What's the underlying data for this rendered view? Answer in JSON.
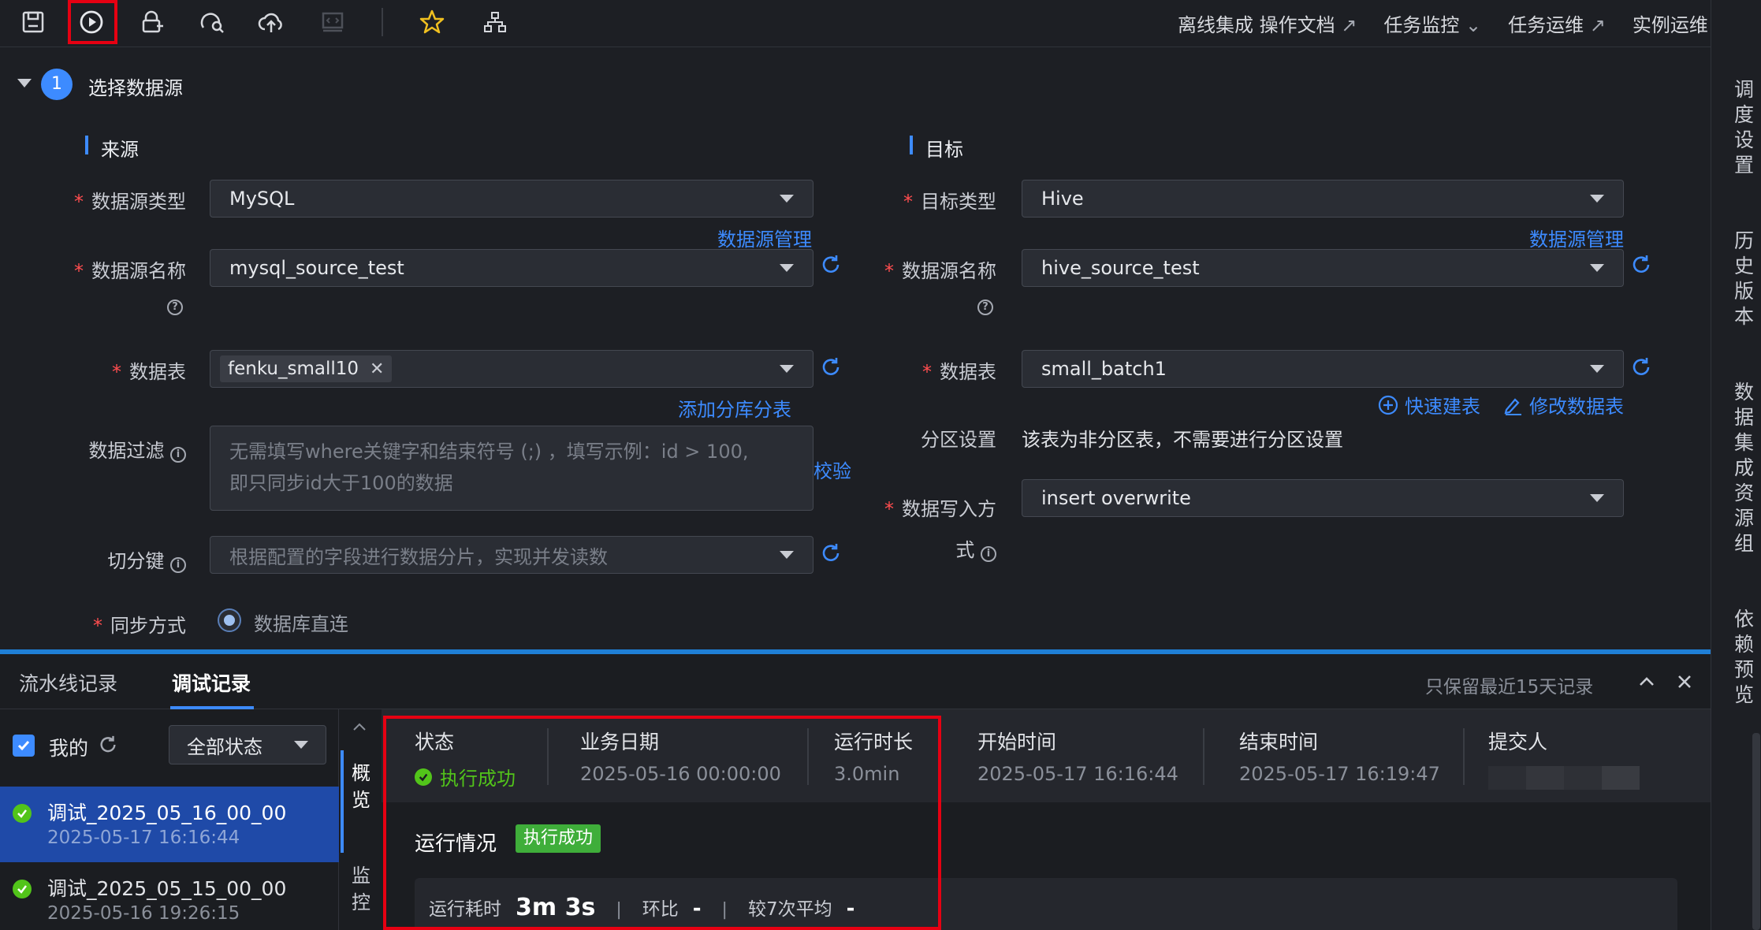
{
  "toolbar": {
    "icons": [
      "save-icon",
      "run-icon",
      "lock-icon",
      "search-icon",
      "cloud-upload-icon",
      "code-icon",
      "star-icon",
      "tree-icon"
    ],
    "links": [
      {
        "label": "离线集成 操作文档",
        "suffix": "↗"
      },
      {
        "label": "任务监控",
        "suffix": "⌄"
      },
      {
        "label": "任务运维",
        "suffix": "↗"
      },
      {
        "label": "实例运维",
        "suffix": "↗"
      }
    ]
  },
  "section": {
    "step": "1",
    "title": "选择数据源"
  },
  "source": {
    "heading": "来源",
    "type_label": "数据源类型",
    "type_value": "MySQL",
    "manage_link": "数据源管理",
    "name_label": "数据源名称",
    "name_value": "mysql_source_test",
    "table_label": "数据表",
    "table_tag": "fenku_small10",
    "add_shard_link": "添加分库分表",
    "filter_label": "数据过滤",
    "filter_placeholder_line1": "无需填写where关键字和结束符号 (;) ，填写示例：id > 100,",
    "filter_placeholder_line2": "即只同步id大于100的数据",
    "verify_link": "校验",
    "split_label": "切分键",
    "split_placeholder": "根据配置的字段进行数据分片，实现并发读数",
    "sync_label": "同步方式",
    "sync_option": "数据库直连"
  },
  "target": {
    "heading": "目标",
    "type_label": "目标类型",
    "type_value": "Hive",
    "manage_link": "数据源管理",
    "name_label": "数据源名称",
    "name_value": "hive_source_test",
    "table_label": "数据表",
    "table_value": "small_batch1",
    "quick_create_link": "快速建表",
    "modify_table_link": "修改数据表",
    "partition_label": "分区设置",
    "partition_text": "该表为非分区表，不需要进行分区设置",
    "write_label_line1": "数据写入方",
    "write_label_line2": "式",
    "write_value": "insert overwrite"
  },
  "right_rail": [
    "调度设置",
    "历史版本",
    "数据集成资源组",
    "依赖预览"
  ],
  "bottom": {
    "tabs": [
      "流水线记录",
      "调试记录"
    ],
    "active_tab": 1,
    "retention_note": "只保留最近15天记录",
    "mine_label": "我的",
    "status_filter": "全部状态",
    "records": [
      {
        "name": "调试_2025_05_16_00_00",
        "time": "2025-05-17 16:16:44"
      },
      {
        "name": "调试_2025_05_15_00_00",
        "time": "2025-05-16 19:26:15"
      }
    ],
    "side_tabs": [
      "概览",
      "监控"
    ],
    "columns": [
      {
        "head": "状态",
        "value": "执行成功"
      },
      {
        "head": "业务日期",
        "value": "2025-05-16 00:00:00"
      },
      {
        "head": "运行时长",
        "value": "3.0min"
      },
      {
        "head": "开始时间",
        "value": "2025-05-17 16:16:44"
      },
      {
        "head": "结束时间",
        "value": "2025-05-17 16:19:47"
      },
      {
        "head": "提交人",
        "value": ""
      }
    ],
    "run_title": "运行情况",
    "run_badge": "执行成功",
    "metrics": {
      "elapsed_label": "运行耗时",
      "elapsed_value": "3m 3s",
      "ratio_label": "环比",
      "ratio_value": "-",
      "avg_label": "较7次平均",
      "avg_value": "-"
    }
  },
  "colors": {
    "accent": "#3d8bff",
    "success": "#52c41a",
    "highlight_box": "#e60012"
  }
}
